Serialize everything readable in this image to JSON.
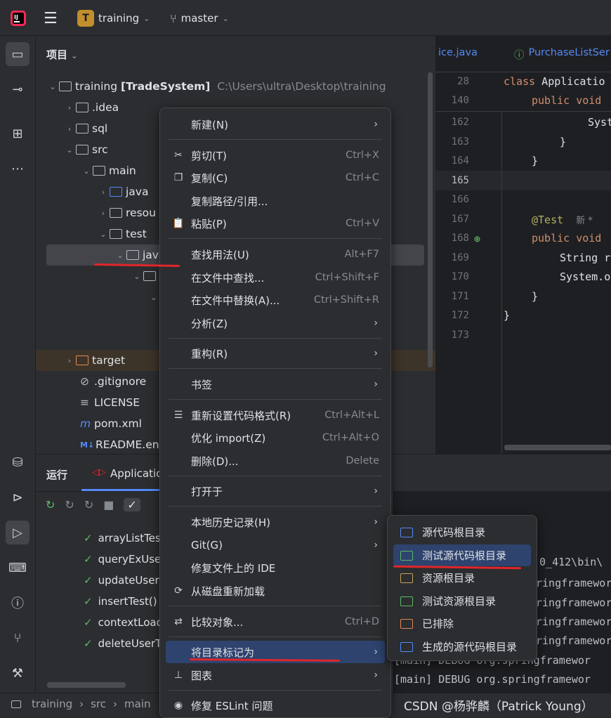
{
  "titlebar": {
    "project_badge": "T",
    "project_name": "training",
    "branch": "master"
  },
  "project_panel": {
    "title": "项目",
    "root_label": "training",
    "root_module": "[TradeSystem]",
    "root_path": "C:\\Users\\ultra\\Desktop\\training",
    "nodes": [
      {
        "label": ".idea"
      },
      {
        "label": "sql"
      },
      {
        "label": "src"
      },
      {
        "label": "main"
      },
      {
        "label": "java"
      },
      {
        "label": "resou"
      },
      {
        "label": "test"
      },
      {
        "label": "jav"
      },
      {
        "label": "target"
      },
      {
        "label": ".gitignore"
      },
      {
        "label": "LICENSE"
      },
      {
        "label": "pom.xml"
      },
      {
        "label": "README.en"
      }
    ]
  },
  "editor": {
    "tabs": [
      "ice.java",
      "PurchaseListSer"
    ],
    "lines": [
      {
        "num": "28",
        "text": "class Applicatio"
      },
      {
        "num": "140",
        "text": "public void"
      },
      {
        "num": "162",
        "text": "Syst"
      },
      {
        "num": "163",
        "text": "}"
      },
      {
        "num": "164",
        "text": "}"
      },
      {
        "num": "165",
        "text": ""
      },
      {
        "num": "166",
        "text": ""
      },
      {
        "num": "167",
        "text": "@Test"
      },
      {
        "num": "168",
        "text": "public void"
      },
      {
        "num": "169",
        "text": "String r"
      },
      {
        "num": "170",
        "text": "System.o"
      },
      {
        "num": "171",
        "text": "}"
      },
      {
        "num": "172",
        "text": "}"
      },
      {
        "num": "173",
        "text": ""
      }
    ],
    "new_marker": "新 *"
  },
  "run_panel": {
    "title": "运行",
    "tab": "Applicatio",
    "tests": [
      "arrayListTes",
      "queryExUse",
      "updateUser",
      "insertTest()",
      "contextLoad",
      "deleteUserT"
    ],
    "console_lines": [
      ".0_412\\bin\\",
      "ringframewor",
      "ringframewor",
      "ringframewor",
      "ringframework",
      "[main] DEBUG org.springframewor",
      "[main] DEBUG org.springframewor"
    ]
  },
  "statusbar": {
    "crumbs": [
      "training",
      "src",
      "main"
    ],
    "watermark": "CSDN @杨骅麟（Patrick Young）"
  },
  "context_menu": {
    "items": [
      {
        "label": "新建(N)",
        "shortcut": ""
      },
      {
        "label": "剪切(T)",
        "shortcut": "Ctrl+X"
      },
      {
        "label": "复制(C)",
        "shortcut": "Ctrl+C"
      },
      {
        "label": "复制路径/引用...",
        "shortcut": ""
      },
      {
        "label": "粘贴(P)",
        "shortcut": "Ctrl+V"
      },
      {
        "label": "查找用法(U)",
        "shortcut": "Alt+F7"
      },
      {
        "label": "在文件中查找...",
        "shortcut": "Ctrl+Shift+F"
      },
      {
        "label": "在文件中替换(A)...",
        "shortcut": "Ctrl+Shift+R"
      },
      {
        "label": "分析(Z)",
        "shortcut": ""
      },
      {
        "label": "重构(R)",
        "shortcut": ""
      },
      {
        "label": "书签",
        "shortcut": ""
      },
      {
        "label": "重新设置代码格式(R)",
        "shortcut": "Ctrl+Alt+L"
      },
      {
        "label": "优化 import(Z)",
        "shortcut": "Ctrl+Alt+O"
      },
      {
        "label": "删除(D)...",
        "shortcut": "Delete"
      },
      {
        "label": "打开于",
        "shortcut": ""
      },
      {
        "label": "本地历史记录(H)",
        "shortcut": ""
      },
      {
        "label": "Git(G)",
        "shortcut": ""
      },
      {
        "label": "修复文件上的 IDE",
        "shortcut": ""
      },
      {
        "label": "从磁盘重新加载",
        "shortcut": ""
      },
      {
        "label": "比较对象...",
        "shortcut": "Ctrl+D"
      },
      {
        "label": "将目录标记为",
        "shortcut": ""
      },
      {
        "label": "图表",
        "shortcut": ""
      },
      {
        "label": "修复 ESLint 问题",
        "shortcut": ""
      }
    ]
  },
  "submenu": {
    "items": [
      "源代码根目录",
      "测试源代码根目录",
      "资源根目录",
      "测试资源根目录",
      "已排除",
      "生成的源代码根目录"
    ]
  },
  "colors": {
    "accent": "#2e436e",
    "annotation_red": "#e0262a",
    "check_green": "#5fb865"
  }
}
